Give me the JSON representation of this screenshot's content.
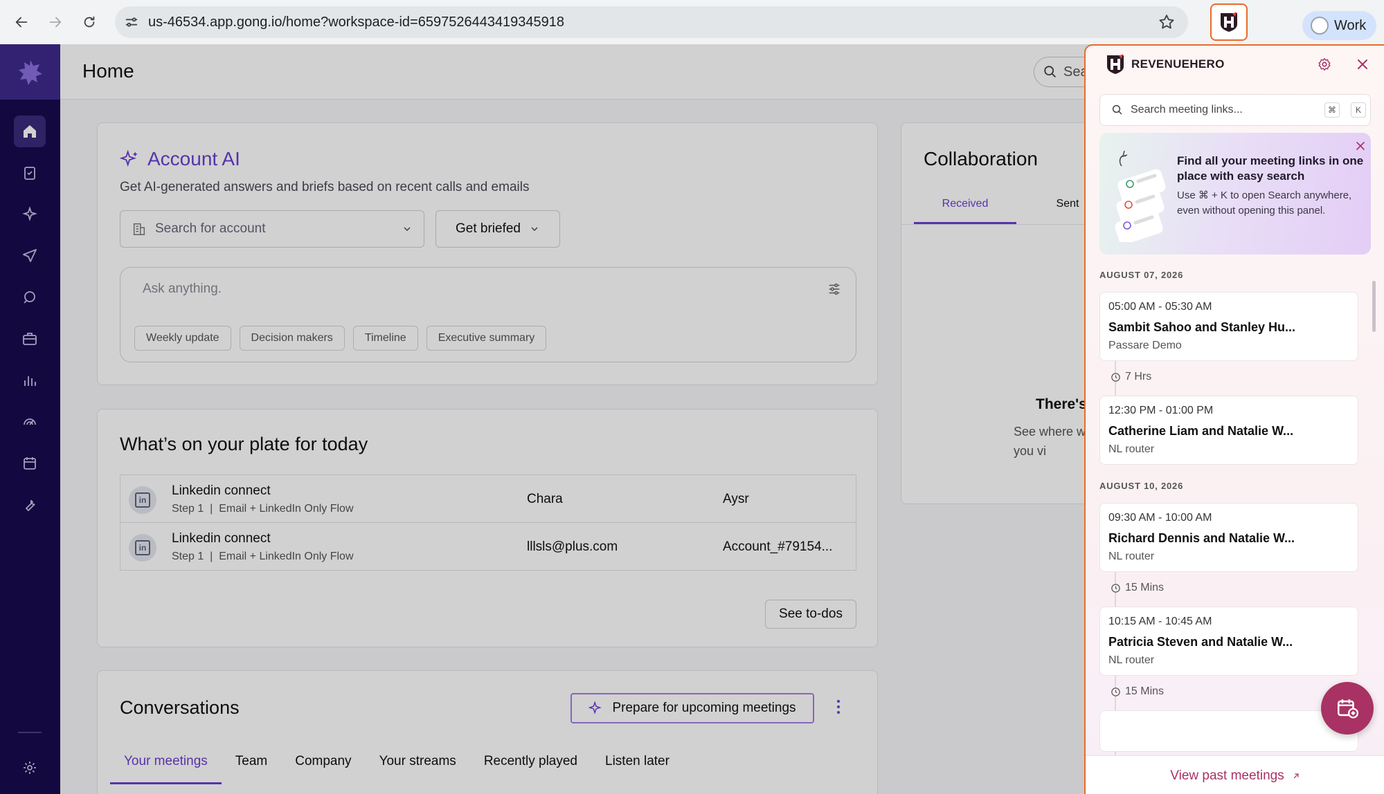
{
  "browser": {
    "url": "us-46534.app.gong.io/home?workspace-id=6597526443419345918",
    "profile_label": "Work"
  },
  "gong": {
    "page_title": "Home",
    "search_placeholder": "Sea",
    "account_ai": {
      "title": "Account AI",
      "subtitle": "Get AI-generated answers and briefs based on recent calls and emails",
      "account_select_placeholder": "Search for account",
      "briefed_button": "Get briefed",
      "ask_placeholder": "Ask anything.",
      "chips": [
        "Weekly update",
        "Decision makers",
        "Timeline",
        "Executive summary"
      ]
    },
    "plate": {
      "title": "What’s on your plate for today",
      "rows": [
        {
          "title": "Linkedin connect",
          "step": "Step 1",
          "flow": "Email + LinkedIn Only Flow",
          "contact": "Chara",
          "account": "Aysr"
        },
        {
          "title": "Linkedin connect",
          "step": "Step 1",
          "flow": "Email + LinkedIn Only Flow",
          "contact": "lllsls@plus.com",
          "account": "Account_#79154..."
        }
      ],
      "see_todos": "See to-dos"
    },
    "conversations": {
      "title": "Conversations",
      "prepare_button": "Prepare for upcoming meetings",
      "tabs": [
        "Your meetings",
        "Team",
        "Company",
        "Your streams",
        "Recently played",
        "Listen later"
      ]
    },
    "collaboration": {
      "title": "Collaboration",
      "tabs": [
        "Received",
        "Sent"
      ],
      "empty_title": "There's",
      "empty_sub": "See where with you vi"
    }
  },
  "revenuehero": {
    "brand": "REVENUEHERO",
    "search_placeholder": "Search meeting links...",
    "shortcut_keys": [
      "⌘",
      "K"
    ],
    "promo": {
      "title": "Find all your meeting links in one place with easy search",
      "body": "Use ⌘ + K to open Search anywhere, even without opening this panel."
    },
    "days": [
      {
        "label": "AUGUST 07, 2026",
        "meetings": [
          {
            "time": "05:00 AM - 05:30 AM",
            "who": "Sambit Sahoo and Stanley Hu...",
            "router": "Passare Demo"
          },
          {
            "gap": "7 Hrs"
          },
          {
            "time": "12:30 PM - 01:00 PM",
            "who": "Catherine Liam  and Natalie W...",
            "router": "NL router"
          }
        ]
      },
      {
        "label": "AUGUST 10, 2026",
        "meetings": [
          {
            "time": "09:30 AM - 10:00 AM",
            "who": "Richard Dennis  and Natalie W...",
            "router": "NL router"
          },
          {
            "gap": "15 Mins"
          },
          {
            "time": "10:15 AM - 10:45 AM",
            "who": "Patricia Steven  and Natalie W...",
            "router": "NL router"
          },
          {
            "gap": "15 Mins"
          }
        ]
      }
    ],
    "footer_link": "View past meetings",
    "colors": {
      "accent": "#a83263",
      "border": "#e96a2c"
    }
  }
}
